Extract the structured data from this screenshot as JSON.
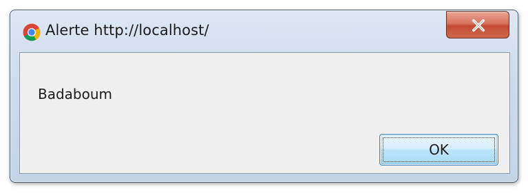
{
  "dialog": {
    "title": "Alerte http://localhost/",
    "app_icon": "chrome-icon",
    "close_icon": "close-icon",
    "message": "Badaboum",
    "ok_label": "OK"
  },
  "colors": {
    "client_bg": "#f0f0f0",
    "close_button": "#c34a33",
    "ok_button_border": "#3c7fb1"
  }
}
